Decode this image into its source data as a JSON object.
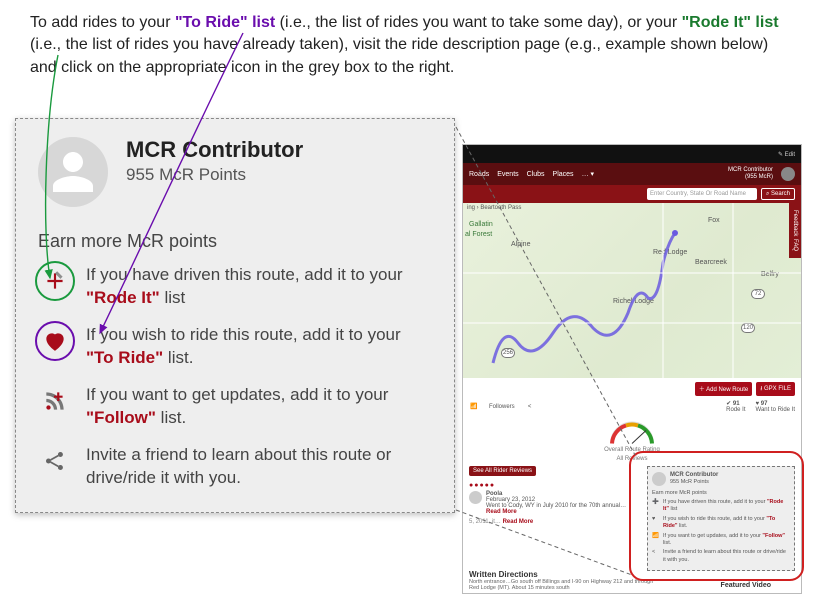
{
  "intro": {
    "p1a": "To add rides to your ",
    "toride": "\"To Ride\" list",
    "p1b": " (i.e., the list of rides you want to take some day), or your ",
    "rodeit": "\"Rode It\" list",
    "p1c": " (i.e., the list of rides you have already taken), visit the ride description page (e.g., example shown below) and click on the appropriate icon in the grey box to the right."
  },
  "callout": {
    "name": "MCR Contributor",
    "points": "955 McR Points",
    "earn": "Earn more McR points",
    "row1a": "If you have driven this route, add it to your ",
    "row1b": "\"Rode It\"",
    "row1c": " list",
    "row2a": "If you wish to ride this route, add it to your ",
    "row2b": "\"To Ride\"",
    "row2c": " list.",
    "row3a": "If you want to get updates, add it to your ",
    "row3b": "\"Follow\"",
    "row3c": " list.",
    "row4": "Invite a friend to learn about this route or drive/ride it with you."
  },
  "mini": {
    "top_edit": "✎ Edit",
    "nav": {
      "roads": "Roads",
      "events": "Events",
      "clubs": "Clubs",
      "places": "Places",
      "more": "… ▾",
      "who_name": "MCR Contributor",
      "who_sub": "(955 McR)"
    },
    "search": {
      "placeholder": "Enter Country, State Or Road Name",
      "btn": "⌕ Search"
    },
    "crumb": "ing › Beartooth Pass",
    "labels": {
      "gallatin": "Gallatin",
      "forest": "al Forest",
      "alpine": "Alpine",
      "fox": "Fox",
      "redlodge": "Red Lodge",
      "bearcreek": "Bearcreek",
      "belfry": "Belfry",
      "richel": "Richel Lodge"
    },
    "hwy": {
      "h72": "72",
      "h120": "120",
      "h256": "256"
    },
    "side": {
      "feedback": "Feedback",
      "faq": "FAQ"
    },
    "buttons": {
      "addroute": "＋ Add New Route",
      "gpx": "⭳ GPX FILE"
    },
    "actions": {
      "followers": "Followers",
      "share": "",
      "rodeit_n": "91",
      "rodeit_t": "Rode It",
      "toride_n": "97",
      "toride_t": "Want to Ride It"
    },
    "gauge_label": "Overall Route Rating",
    "allreviews": "All Reviews",
    "seeall": "See All Rider Reviews",
    "review": {
      "user": "Poola",
      "date": "February 23, 2012",
      "text": "Went to Cody, WY in July 2010 for the 70th annual…",
      "dots": "●●●●●",
      "readmore": "Read More"
    },
    "bottomdate": "5, 2011, it…",
    "minicallout": {
      "name": "MCR Contributor",
      "pts": "955 McR Points",
      "earn": "Earn more McR points",
      "r1a": "If you have driven this route, add it to your ",
      "r1b": "\"Rode It\"",
      "r1c": " list",
      "r2a": "If you wish to ride this route, add it to your ",
      "r2b": "\"To Ride\"",
      "r2c": " list.",
      "r3a": "If you want to get updates, add it to your ",
      "r3b": "\"Follow\"",
      "r3c": " list.",
      "r4": "Invite a friend to learn about this route or drive/ride it with you."
    },
    "wd_title": "Written Directions",
    "wd_text": "North entrance…Go south off Billings and I-90 on Highway 212 and through Red Lodge (MT). About 15 minutes south",
    "featured": "Featured Video"
  }
}
